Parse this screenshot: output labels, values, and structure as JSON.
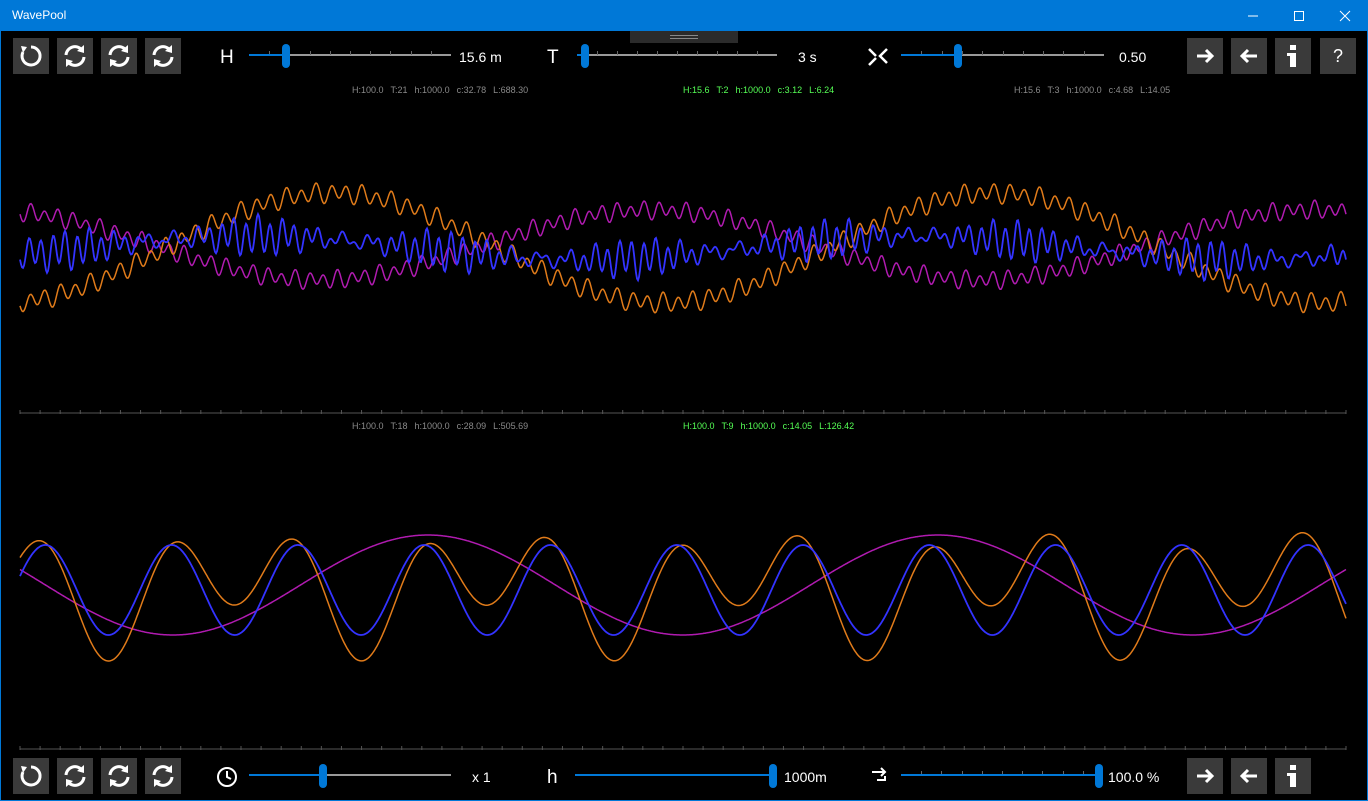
{
  "window": {
    "title": "WavePool"
  },
  "top_controls": {
    "h_label": "H",
    "h_value": "15.6 m",
    "h_fraction": 0.17,
    "t_label": "T",
    "t_value": "3 s",
    "t_fraction": 0.02,
    "ratio_value": "0.50",
    "ratio_fraction": 0.27
  },
  "bottom_controls": {
    "speed_value": "x 1",
    "speed_fraction": 0.36,
    "depth_label": "h",
    "depth_value": "1000m",
    "depth_fraction": 1.0,
    "mix_value": "100.0 %",
    "mix_fraction": 1.0
  },
  "top_panel": {
    "left_info": [
      "H:100.0",
      "T:21",
      "h:1000.0",
      "c:32.78",
      "L:688.30"
    ],
    "center_info": [
      "H:15.6",
      "T:2",
      "h:1000.0",
      "c:3.12",
      "L:6.24"
    ],
    "right_info": [
      "H:15.6",
      "T:3",
      "h:1000.0",
      "c:4.68",
      "L:14.05"
    ]
  },
  "bottom_panel": {
    "left_info": [
      "H:100.0",
      "T:18",
      "h:1000.0",
      "c:28.09",
      "L:505.69"
    ],
    "center_info": [
      "H:100.0",
      "T:9",
      "h:1000.0",
      "c:14.05",
      "L:126.42"
    ]
  },
  "help": {
    "label": "?"
  },
  "colors": {
    "orange": "#e07b1a",
    "blue": "#3333ff",
    "magenta": "#b01bb0",
    "accent": "#0078d7",
    "info_active": "#55ff55"
  },
  "icons": [
    "reset-icon",
    "sync-icon",
    "clock-icon",
    "cross-arrows-icon",
    "swap-icon",
    "arrow-right-icon",
    "arrow-left-icon",
    "info-icon"
  ]
}
